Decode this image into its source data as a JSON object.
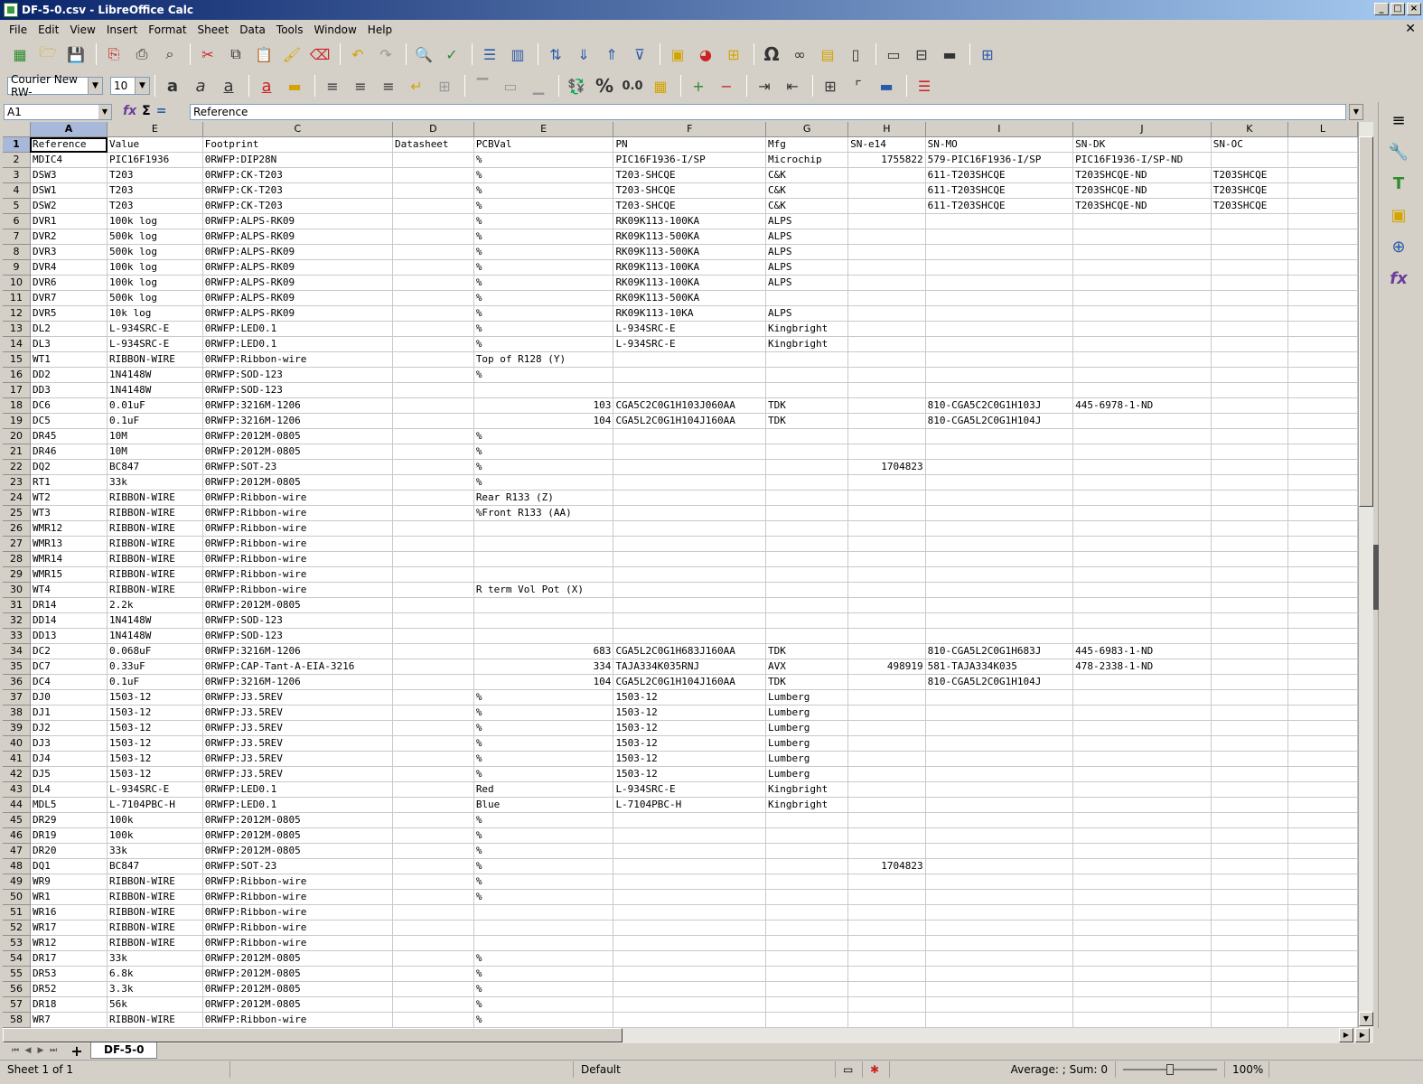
{
  "window": {
    "title": "DF-5-0.csv - LibreOffice Calc"
  },
  "menu": [
    "File",
    "Edit",
    "View",
    "Insert",
    "Format",
    "Sheet",
    "Data",
    "Tools",
    "Window",
    "Help"
  ],
  "format_toolbar": {
    "font_name": "Courier New RW-",
    "font_size": "10"
  },
  "formula_bar": {
    "cell_ref": "A1",
    "content": "Reference"
  },
  "columns": [
    "A",
    "E",
    "C",
    "D",
    "E",
    "F",
    "G",
    "H",
    "I",
    "J",
    "K",
    "L"
  ],
  "rows": [
    [
      "Reference",
      "Value",
      "Footprint",
      "Datasheet",
      "PCBVal",
      "PN",
      "Mfg",
      "SN-e14",
      "SN-MO",
      "SN-DK",
      "SN-OC",
      ""
    ],
    [
      "MDIC4",
      "PIC16F1936",
      "0RWFP:DIP28N",
      "",
      "%",
      "PIC16F1936-I/SP",
      "Microchip",
      "1755822",
      "579-PIC16F1936-I/SP",
      "PIC16F1936-I/SP-ND",
      "",
      ""
    ],
    [
      "DSW3",
      "T203",
      "0RWFP:CK-T203",
      "",
      "%",
      "T203-SHCQE",
      "C&K",
      "",
      "611-T203SHCQE",
      "T203SHCQE-ND",
      "T203SHCQE",
      ""
    ],
    [
      "DSW1",
      "T203",
      "0RWFP:CK-T203",
      "",
      "%",
      "T203-SHCQE",
      "C&K",
      "",
      "611-T203SHCQE",
      "T203SHCQE-ND",
      "T203SHCQE",
      ""
    ],
    [
      "DSW2",
      "T203",
      "0RWFP:CK-T203",
      "",
      "%",
      "T203-SHCQE",
      "C&K",
      "",
      "611-T203SHCQE",
      "T203SHCQE-ND",
      "T203SHCQE",
      ""
    ],
    [
      "DVR1",
      "100k log",
      "0RWFP:ALPS-RK09",
      "",
      "%",
      "RK09K113-100KA",
      "ALPS",
      "",
      "",
      "",
      "",
      ""
    ],
    [
      "DVR2",
      "500k log",
      "0RWFP:ALPS-RK09",
      "",
      "%",
      "RK09K113-500KA",
      "ALPS",
      "",
      "",
      "",
      "",
      ""
    ],
    [
      "DVR3",
      "500k log",
      "0RWFP:ALPS-RK09",
      "",
      "%",
      "RK09K113-500KA",
      "ALPS",
      "",
      "",
      "",
      "",
      ""
    ],
    [
      "DVR4",
      "100k log",
      "0RWFP:ALPS-RK09",
      "",
      "%",
      "RK09K113-100KA",
      "ALPS",
      "",
      "",
      "",
      "",
      ""
    ],
    [
      "DVR6",
      "100k log",
      "0RWFP:ALPS-RK09",
      "",
      "%",
      "RK09K113-100KA",
      "ALPS",
      "",
      "",
      "",
      "",
      ""
    ],
    [
      "DVR7",
      "500k log",
      "0RWFP:ALPS-RK09",
      "",
      "%",
      "RK09K113-500KA",
      "",
      "",
      "",
      "",
      "",
      ""
    ],
    [
      "DVR5",
      "10k log",
      "0RWFP:ALPS-RK09",
      "",
      "%",
      "RK09K113-10KA",
      "ALPS",
      "",
      "",
      "",
      "",
      ""
    ],
    [
      "DL2",
      "L-934SRC-E",
      "0RWFP:LED0.1",
      "",
      "%",
      "L-934SRC-E",
      "Kingbright",
      "",
      "",
      "",
      "",
      ""
    ],
    [
      "DL3",
      "L-934SRC-E",
      "0RWFP:LED0.1",
      "",
      "%",
      "L-934SRC-E",
      "Kingbright",
      "",
      "",
      "",
      "",
      ""
    ],
    [
      "WT1",
      "RIBBON-WIRE",
      "0RWFP:Ribbon-wire",
      "",
      "Top of R128 (Y)",
      "",
      "",
      "",
      "",
      "",
      "",
      ""
    ],
    [
      "DD2",
      "1N4148W",
      "0RWFP:SOD-123",
      "",
      "%",
      "",
      "",
      "",
      "",
      "",
      "",
      ""
    ],
    [
      "DD3",
      "1N4148W",
      "0RWFP:SOD-123",
      "",
      "",
      "",
      "",
      "",
      "",
      "",
      "",
      ""
    ],
    [
      "DC6",
      "0.01uF",
      "0RWFP:3216M-1206",
      "",
      "103",
      "CGA5C2C0G1H103J060AA",
      "TDK",
      "",
      "810-CGA5C2C0G1H103J",
      "445-6978-1-ND",
      "",
      ""
    ],
    [
      "DC5",
      "0.1uF",
      "0RWFP:3216M-1206",
      "",
      "104",
      "CGA5L2C0G1H104J160AA",
      "TDK",
      "",
      "810-CGA5L2C0G1H104J",
      "",
      "",
      ""
    ],
    [
      "DR45",
      "10M",
      "0RWFP:2012M-0805",
      "",
      "%",
      "",
      "",
      "",
      "",
      "",
      "",
      ""
    ],
    [
      "DR46",
      "10M",
      "0RWFP:2012M-0805",
      "",
      "%",
      "",
      "",
      "",
      "",
      "",
      "",
      ""
    ],
    [
      "DQ2",
      "BC847",
      "0RWFP:SOT-23",
      "",
      "%",
      "",
      "",
      "1704823",
      "",
      "",
      "",
      ""
    ],
    [
      "RT1",
      "33k",
      "0RWFP:2012M-0805",
      "",
      "%",
      "",
      "",
      "",
      "",
      "",
      "",
      ""
    ],
    [
      "WT2",
      "RIBBON-WIRE",
      "0RWFP:Ribbon-wire",
      "",
      "Rear R133 (Z)",
      "",
      "",
      "",
      "",
      "",
      "",
      ""
    ],
    [
      "WT3",
      "RIBBON-WIRE",
      "0RWFP:Ribbon-wire",
      "",
      "%Front R133 (AA)",
      "",
      "",
      "",
      "",
      "",
      "",
      ""
    ],
    [
      "WMR12",
      "RIBBON-WIRE",
      "0RWFP:Ribbon-wire",
      "",
      "",
      "",
      "",
      "",
      "",
      "",
      "",
      ""
    ],
    [
      "WMR13",
      "RIBBON-WIRE",
      "0RWFP:Ribbon-wire",
      "",
      "",
      "",
      "",
      "",
      "",
      "",
      "",
      ""
    ],
    [
      "WMR14",
      "RIBBON-WIRE",
      "0RWFP:Ribbon-wire",
      "",
      "",
      "",
      "",
      "",
      "",
      "",
      "",
      ""
    ],
    [
      "WMR15",
      "RIBBON-WIRE",
      "0RWFP:Ribbon-wire",
      "",
      "",
      "",
      "",
      "",
      "",
      "",
      "",
      ""
    ],
    [
      "WT4",
      "RIBBON-WIRE",
      "0RWFP:Ribbon-wire",
      "",
      "R term Vol Pot (X)",
      "",
      "",
      "",
      "",
      "",
      "",
      ""
    ],
    [
      "DR14",
      "2.2k",
      "0RWFP:2012M-0805",
      "",
      "",
      "",
      "",
      "",
      "",
      "",
      "",
      ""
    ],
    [
      "DD14",
      "1N4148W",
      "0RWFP:SOD-123",
      "",
      "",
      "",
      "",
      "",
      "",
      "",
      "",
      ""
    ],
    [
      "DD13",
      "1N4148W",
      "0RWFP:SOD-123",
      "",
      "",
      "",
      "",
      "",
      "",
      "",
      "",
      ""
    ],
    [
      "DC2",
      "0.068uF",
      "0RWFP:3216M-1206",
      "",
      "683",
      "CGA5L2C0G1H683J160AA",
      "TDK",
      "",
      "810-CGA5L2C0G1H683J",
      "445-6983-1-ND",
      "",
      ""
    ],
    [
      "DC7",
      "0.33uF",
      "0RWFP:CAP-Tant-A-EIA-3216",
      "",
      "334",
      "TAJA334K035RNJ",
      "AVX",
      "498919",
      "581-TAJA334K035",
      "478-2338-1-ND",
      "",
      ""
    ],
    [
      "DC4",
      "0.1uF",
      "0RWFP:3216M-1206",
      "",
      "104",
      "CGA5L2C0G1H104J160AA",
      "TDK",
      "",
      "810-CGA5L2C0G1H104J",
      "",
      "",
      ""
    ],
    [
      "DJ0",
      "1503-12",
      "0RWFP:J3.5REV",
      "",
      "%",
      "1503-12",
      "Lumberg",
      "",
      "",
      "",
      "",
      ""
    ],
    [
      "DJ1",
      "1503-12",
      "0RWFP:J3.5REV",
      "",
      "%",
      "1503-12",
      "Lumberg",
      "",
      "",
      "",
      "",
      ""
    ],
    [
      "DJ2",
      "1503-12",
      "0RWFP:J3.5REV",
      "",
      "%",
      "1503-12",
      "Lumberg",
      "",
      "",
      "",
      "",
      ""
    ],
    [
      "DJ3",
      "1503-12",
      "0RWFP:J3.5REV",
      "",
      "%",
      "1503-12",
      "Lumberg",
      "",
      "",
      "",
      "",
      ""
    ],
    [
      "DJ4",
      "1503-12",
      "0RWFP:J3.5REV",
      "",
      "%",
      "1503-12",
      "Lumberg",
      "",
      "",
      "",
      "",
      ""
    ],
    [
      "DJ5",
      "1503-12",
      "0RWFP:J3.5REV",
      "",
      "%",
      "1503-12",
      "Lumberg",
      "",
      "",
      "",
      "",
      ""
    ],
    [
      "DL4",
      "L-934SRC-E",
      "0RWFP:LED0.1",
      "",
      "Red",
      "L-934SRC-E",
      "Kingbright",
      "",
      "",
      "",
      "",
      ""
    ],
    [
      "MDL5",
      "L-7104PBC-H",
      "0RWFP:LED0.1",
      "",
      "Blue",
      "L-7104PBC-H",
      "Kingbright",
      "",
      "",
      "",
      "",
      ""
    ],
    [
      "DR29",
      "100k",
      "0RWFP:2012M-0805",
      "",
      "%",
      "",
      "",
      "",
      "",
      "",
      "",
      ""
    ],
    [
      "DR19",
      "100k",
      "0RWFP:2012M-0805",
      "",
      "%",
      "",
      "",
      "",
      "",
      "",
      "",
      ""
    ],
    [
      "DR20",
      "33k",
      "0RWFP:2012M-0805",
      "",
      "%",
      "",
      "",
      "",
      "",
      "",
      "",
      ""
    ],
    [
      "DQ1",
      "BC847",
      "0RWFP:SOT-23",
      "",
      "%",
      "",
      "",
      "1704823",
      "",
      "",
      "",
      ""
    ],
    [
      "WR9",
      "RIBBON-WIRE",
      "0RWFP:Ribbon-wire",
      "",
      "%",
      "",
      "",
      "",
      "",
      "",
      "",
      ""
    ],
    [
      "WR1",
      "RIBBON-WIRE",
      "0RWFP:Ribbon-wire",
      "",
      "%",
      "",
      "",
      "",
      "",
      "",
      "",
      ""
    ],
    [
      "WR16",
      "RIBBON-WIRE",
      "0RWFP:Ribbon-wire",
      "",
      "",
      "",
      "",
      "",
      "",
      "",
      "",
      ""
    ],
    [
      "WR17",
      "RIBBON-WIRE",
      "0RWFP:Ribbon-wire",
      "",
      "",
      "",
      "",
      "",
      "",
      "",
      "",
      ""
    ],
    [
      "WR12",
      "RIBBON-WIRE",
      "0RWFP:Ribbon-wire",
      "",
      "",
      "",
      "",
      "",
      "",
      "",
      "",
      ""
    ],
    [
      "DR17",
      "33k",
      "0RWFP:2012M-0805",
      "",
      "%",
      "",
      "",
      "",
      "",
      "",
      "",
      ""
    ],
    [
      "DR53",
      "6.8k",
      "0RWFP:2012M-0805",
      "",
      "%",
      "",
      "",
      "",
      "",
      "",
      "",
      ""
    ],
    [
      "DR52",
      "3.3k",
      "0RWFP:2012M-0805",
      "",
      "%",
      "",
      "",
      "",
      "",
      "",
      "",
      ""
    ],
    [
      "DR18",
      "56k",
      "0RWFP:2012M-0805",
      "",
      "%",
      "",
      "",
      "",
      "",
      "",
      "",
      ""
    ],
    [
      "WR7",
      "RIBBON-WIRE",
      "0RWFP:Ribbon-wire",
      "",
      "%",
      "",
      "",
      "",
      "",
      "",
      "",
      ""
    ]
  ],
  "sheet_tabs": [
    "DF-5-0"
  ],
  "status": {
    "sheet": "Sheet 1 of 1",
    "style": "Default",
    "sum": "Average: ; Sum: 0",
    "zoom": "100%"
  }
}
